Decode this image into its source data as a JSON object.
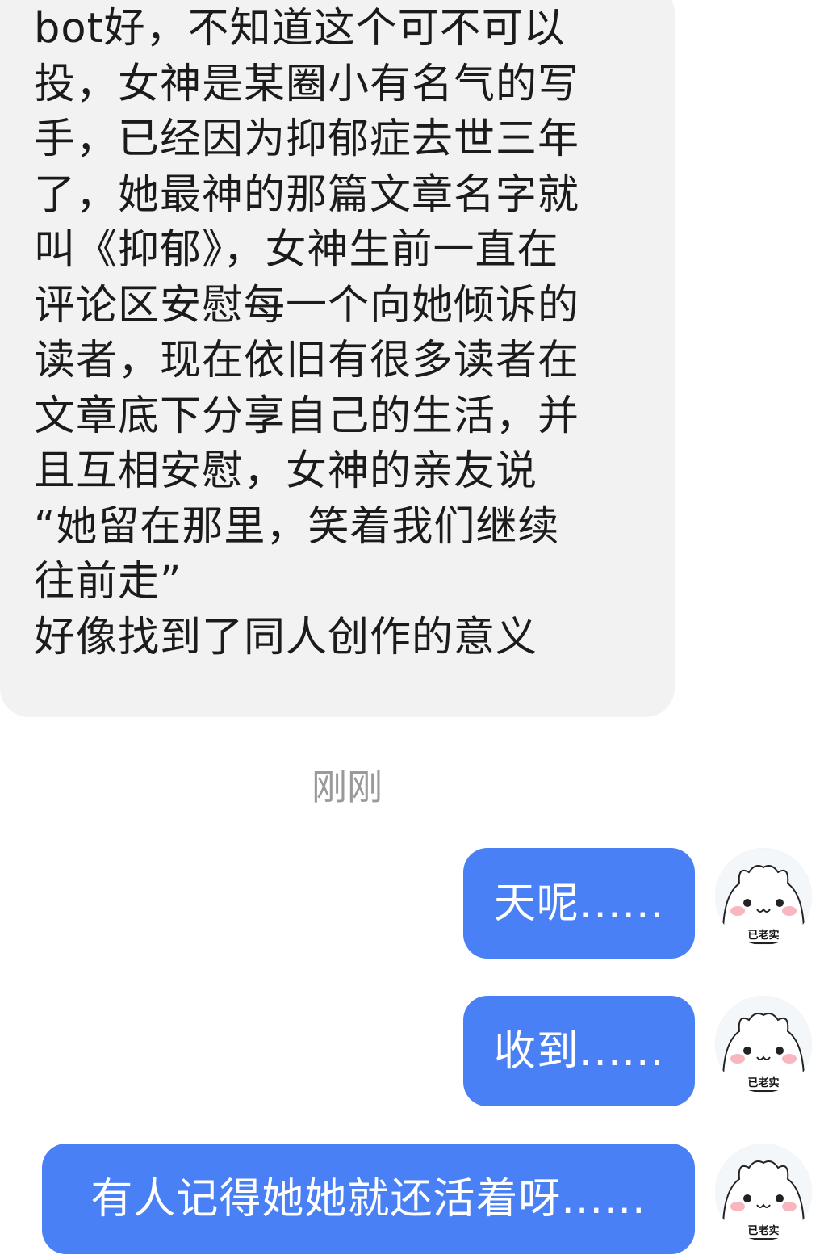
{
  "incoming_message": {
    "text": "bot好，不知道这个可不可以\n投，女神是某圈小有名气的写\n手，已经因为抑郁症去世三年\n了，她最神的那篇文章名字就\n叫《抑郁》，女神生前一直在\n评论区安慰每一个向她倾诉的\n读者，现在依旧有很多读者在\n文章底下分享自己的生活，并\n且互相安慰，女神的亲友说\n“她留在那里，笑着我们继续\n往前走”\n好像找到了同人创作的意义"
  },
  "timestamp": "刚刚",
  "outgoing_messages": [
    {
      "text": "天呢......"
    },
    {
      "text": "收到......"
    },
    {
      "text": "有人记得她她就还活着呀......"
    }
  ],
  "avatar": {
    "icon": "white-hamster-face-icon",
    "caption": "已老实",
    "colors": {
      "face": "#ffffff",
      "background": "#f4f7f9",
      "blush": "#f7a9b4",
      "outline": "#222222"
    }
  },
  "colors": {
    "incoming_bubble": "#f2f2f3",
    "outgoing_bubble": "#4a80f5",
    "incoming_text": "#1b1b1b",
    "outgoing_text": "#ffffff",
    "timestamp": "#9a9a9a"
  }
}
